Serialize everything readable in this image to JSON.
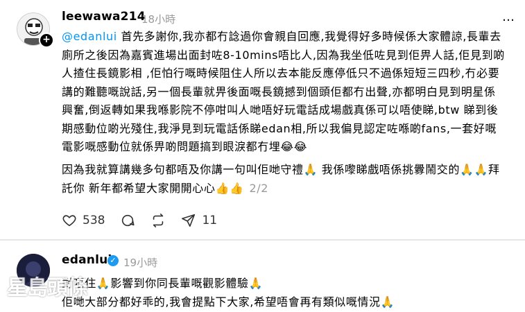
{
  "post1": {
    "username": "leewawa214",
    "time": "18小時",
    "more_icon": "…",
    "mention": "@edanlui",
    "body_text": " 首先多謝你,我亦都冇諗過你會親自回應,我覺得好多時候係大家體諒,長輩去廁所之後因為嘉賓進場出面封咗8-10mins唔比人,因為我坐低咗見到佢畀人話,佢見到啲人揸住長鏡影相 ,佢怕行嘅時候阻住人所以去本能反應停低只不過係短短三四秒,冇必要講的難聽嘅說話,另一個長輩就畀後面嘅長鏡撼到個頭佢都冇出聲,亦都明白見到明星係興奮,倒返轉如果我喺影院不停咁叫人哋唔好玩電話成場戲真係可以唔使睇,btw 睇到後期感動位啲光殘住,我淨見到玩電話係睇edan相,所以我偏見認定咗喺啲fans,一套好嘅電影嘅感動位就係畀啲問題搞到眼淚都冇埋😂😂",
    "body_text2": "因為我就算講幾多句都唔及你講一句叫佢哋守禮🙏 我係嚟睇戲唔係挑釁鬧交的🙏🙏拜託你 新年都希望大家開開心心👍👍",
    "page_counter": "2/2",
    "likes": "538",
    "reposts": "11"
  },
  "post2": {
    "username": "edanlui",
    "time": "19小時",
    "body_text": "對唔住🙏影響到你同長輩嘅觀影體驗🙏\n佢哋大部分都好乖的,我會提點下大家,希望唔會再有類似嘅情況🙏"
  },
  "watermark": "星島頭條",
  "colors": {
    "mention": "#0095f6",
    "muted": "#999999",
    "verified": "#1d9bf0"
  },
  "icons": [
    "heart-icon",
    "comment-icon",
    "repost-icon",
    "share-icon",
    "plus-icon",
    "verified-icon",
    "more-icon"
  ]
}
